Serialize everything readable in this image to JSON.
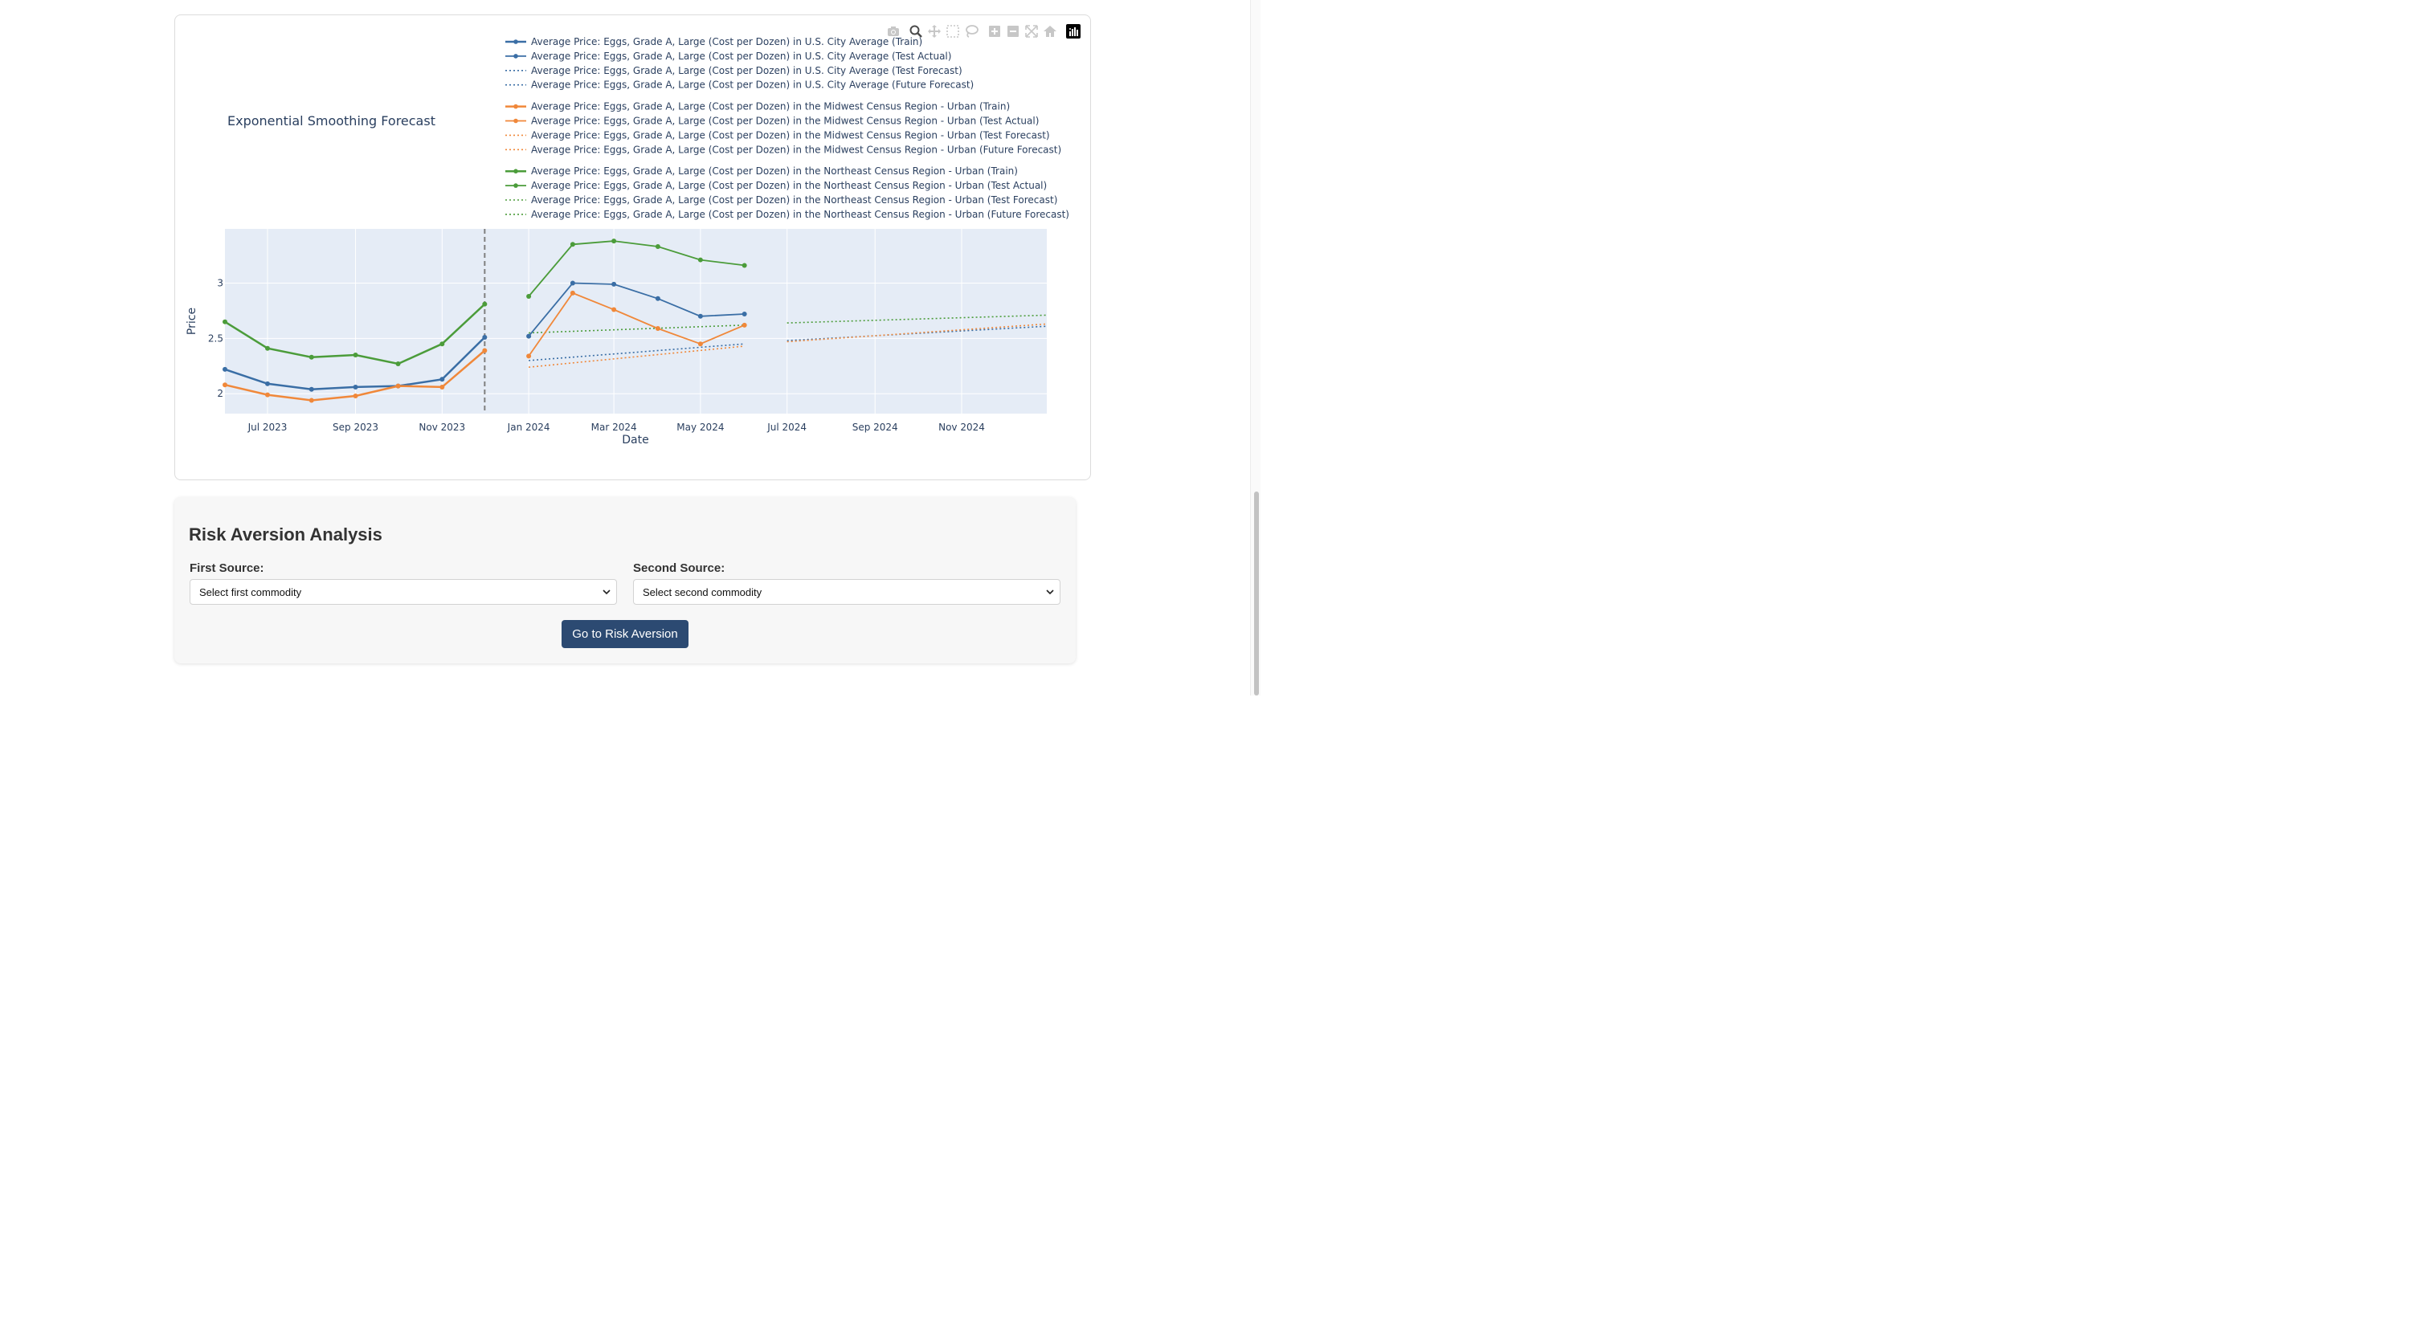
{
  "chart_data": {
    "type": "line",
    "title": "Exponential Smoothing Forecast",
    "xlabel": "Date",
    "ylabel": "Price",
    "x_tick_labels": [
      "Jul 2023",
      "Sep 2023",
      "Nov 2023",
      "Jan 2024",
      "Mar 2024",
      "May 2024",
      "Jul 2024",
      "Sep 2024",
      "Nov 2024"
    ],
    "y_tick_labels": [
      "2",
      "2.5",
      "3"
    ],
    "x_range": [
      "2023-06-01",
      "2024-12-31"
    ],
    "y_range": [
      1.82,
      3.49
    ],
    "grid": true,
    "legend_position": "top-right",
    "split_date": "2023-12-01",
    "series": [
      {
        "name": "Average Price: Eggs, Grade A, Large (Cost per Dozen) in U.S. City Average (Train)",
        "color": "#3a6ea5",
        "style": "solid-markers",
        "group": "us",
        "points": [
          [
            "2023-06-01",
            2.22
          ],
          [
            "2023-07-01",
            2.09
          ],
          [
            "2023-08-01",
            2.04
          ],
          [
            "2023-09-01",
            2.06
          ],
          [
            "2023-10-01",
            2.07
          ],
          [
            "2023-11-01",
            2.13
          ],
          [
            "2023-12-01",
            2.51
          ]
        ]
      },
      {
        "name": "Average Price: Eggs, Grade A, Large (Cost per Dozen) in U.S. City Average (Test Actual)",
        "color": "#3a6ea5",
        "style": "thin-markers",
        "group": "us",
        "points": [
          [
            "2024-01-01",
            2.52
          ],
          [
            "2024-02-01",
            3.0
          ],
          [
            "2024-03-01",
            2.99
          ],
          [
            "2024-04-01",
            2.86
          ],
          [
            "2024-05-01",
            2.7
          ],
          [
            "2024-06-01",
            2.72
          ]
        ]
      },
      {
        "name": "Average Price: Eggs, Grade A, Large (Cost per Dozen) in U.S. City Average (Test Forecast)",
        "color": "#3a6ea5",
        "style": "dotted",
        "group": "us",
        "points": [
          [
            "2024-01-01",
            2.3
          ],
          [
            "2024-06-01",
            2.45
          ]
        ]
      },
      {
        "name": "Average Price: Eggs, Grade A, Large (Cost per Dozen) in U.S. City Average (Future Forecast)",
        "color": "#3a6ea5",
        "style": "dotted",
        "group": "us",
        "points": [
          [
            "2024-07-01",
            2.48
          ],
          [
            "2024-12-31",
            2.61
          ]
        ]
      },
      {
        "name": "Average Price: Eggs, Grade A, Large (Cost per Dozen) in the Midwest Census Region - Urban (Train)",
        "color": "#f0883a",
        "style": "solid-markers",
        "group": "mw",
        "points": [
          [
            "2023-06-01",
            2.08
          ],
          [
            "2023-07-01",
            1.99
          ],
          [
            "2023-08-01",
            1.94
          ],
          [
            "2023-09-01",
            1.98
          ],
          [
            "2023-10-01",
            2.07
          ],
          [
            "2023-11-01",
            2.06
          ],
          [
            "2023-12-01",
            2.39
          ]
        ]
      },
      {
        "name": "Average Price: Eggs, Grade A, Large (Cost per Dozen) in the Midwest Census Region - Urban (Test Actual)",
        "color": "#f0883a",
        "style": "thin-markers",
        "group": "mw",
        "points": [
          [
            "2024-01-01",
            2.34
          ],
          [
            "2024-02-01",
            2.91
          ],
          [
            "2024-03-01",
            2.76
          ],
          [
            "2024-04-01",
            2.59
          ],
          [
            "2024-05-01",
            2.45
          ],
          [
            "2024-06-01",
            2.62
          ]
        ]
      },
      {
        "name": "Average Price: Eggs, Grade A, Large (Cost per Dozen) in the Midwest Census Region - Urban (Test Forecast)",
        "color": "#f0883a",
        "style": "dotted",
        "group": "mw",
        "points": [
          [
            "2024-01-01",
            2.24
          ],
          [
            "2024-06-01",
            2.43
          ]
        ]
      },
      {
        "name": "Average Price: Eggs, Grade A, Large (Cost per Dozen) in the Midwest Census Region - Urban (Future Forecast)",
        "color": "#f0883a",
        "style": "dotted",
        "group": "mw",
        "points": [
          [
            "2024-07-01",
            2.47
          ],
          [
            "2024-12-31",
            2.63
          ]
        ]
      },
      {
        "name": "Average Price: Eggs, Grade A, Large (Cost per Dozen) in the Northeast Census Region - Urban (Train)",
        "color": "#4b9c3a",
        "style": "solid-markers",
        "group": "ne",
        "points": [
          [
            "2023-06-01",
            2.65
          ],
          [
            "2023-07-01",
            2.41
          ],
          [
            "2023-08-01",
            2.33
          ],
          [
            "2023-09-01",
            2.35
          ],
          [
            "2023-10-01",
            2.27
          ],
          [
            "2023-11-01",
            2.45
          ],
          [
            "2023-12-01",
            2.81
          ]
        ]
      },
      {
        "name": "Average Price: Eggs, Grade A, Large (Cost per Dozen) in the Northeast Census Region - Urban (Test Actual)",
        "color": "#4b9c3a",
        "style": "thin-markers",
        "group": "ne",
        "points": [
          [
            "2024-01-01",
            2.88
          ],
          [
            "2024-02-01",
            3.35
          ],
          [
            "2024-03-01",
            3.38
          ],
          [
            "2024-04-01",
            3.33
          ],
          [
            "2024-05-01",
            3.21
          ],
          [
            "2024-06-01",
            3.16
          ]
        ]
      },
      {
        "name": "Average Price: Eggs, Grade A, Large (Cost per Dozen) in the Northeast Census Region - Urban (Test Forecast)",
        "color": "#4b9c3a",
        "style": "dotted",
        "group": "ne",
        "points": [
          [
            "2024-01-01",
            2.55
          ],
          [
            "2024-06-01",
            2.62
          ]
        ]
      },
      {
        "name": "Average Price: Eggs, Grade A, Large (Cost per Dozen) in the Northeast Census Region - Urban (Future Forecast)",
        "color": "#4b9c3a",
        "style": "dotted",
        "group": "ne",
        "points": [
          [
            "2024-07-01",
            2.64
          ],
          [
            "2024-12-31",
            2.71
          ]
        ]
      }
    ]
  },
  "modebar": {
    "icons": [
      "camera-icon",
      "zoom-icon",
      "pan-icon",
      "box-select-icon",
      "lasso-icon",
      "zoom-in-icon",
      "zoom-out-icon",
      "autoscale-icon",
      "reset-axes-icon",
      "plotly-logo-icon"
    ]
  },
  "risk": {
    "title": "Risk Aversion Analysis",
    "first_label": "First Source:",
    "first_placeholder": "Select first commodity",
    "second_label": "Second Source:",
    "second_placeholder": "Select second commodity",
    "button_label": "Go to Risk Aversion"
  },
  "colors": {
    "plot_bg": "#e5ecf6",
    "button_bg": "#2c4a72"
  }
}
